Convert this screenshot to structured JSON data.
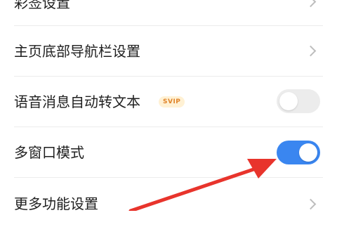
{
  "settings": {
    "items": [
      {
        "label": "彩签设置",
        "control": "chevron"
      },
      {
        "label": "主页底部导航栏设置",
        "control": "chevron"
      },
      {
        "label": "语音消息自动转文本",
        "badge": "SVIP",
        "control": "toggle",
        "toggle_on": false
      },
      {
        "label": "多窗口模式",
        "control": "toggle",
        "toggle_on": true
      },
      {
        "label": "更多功能设置",
        "control": "chevron"
      }
    ]
  },
  "colors": {
    "toggle_on": "#3a86f0",
    "toggle_off": "#ececec",
    "badge_text": "#e0842a",
    "badge_bg": "#fff1d4",
    "annotation_arrow": "#e8342c"
  },
  "icons": {
    "chevron": "chevron-right-icon"
  }
}
